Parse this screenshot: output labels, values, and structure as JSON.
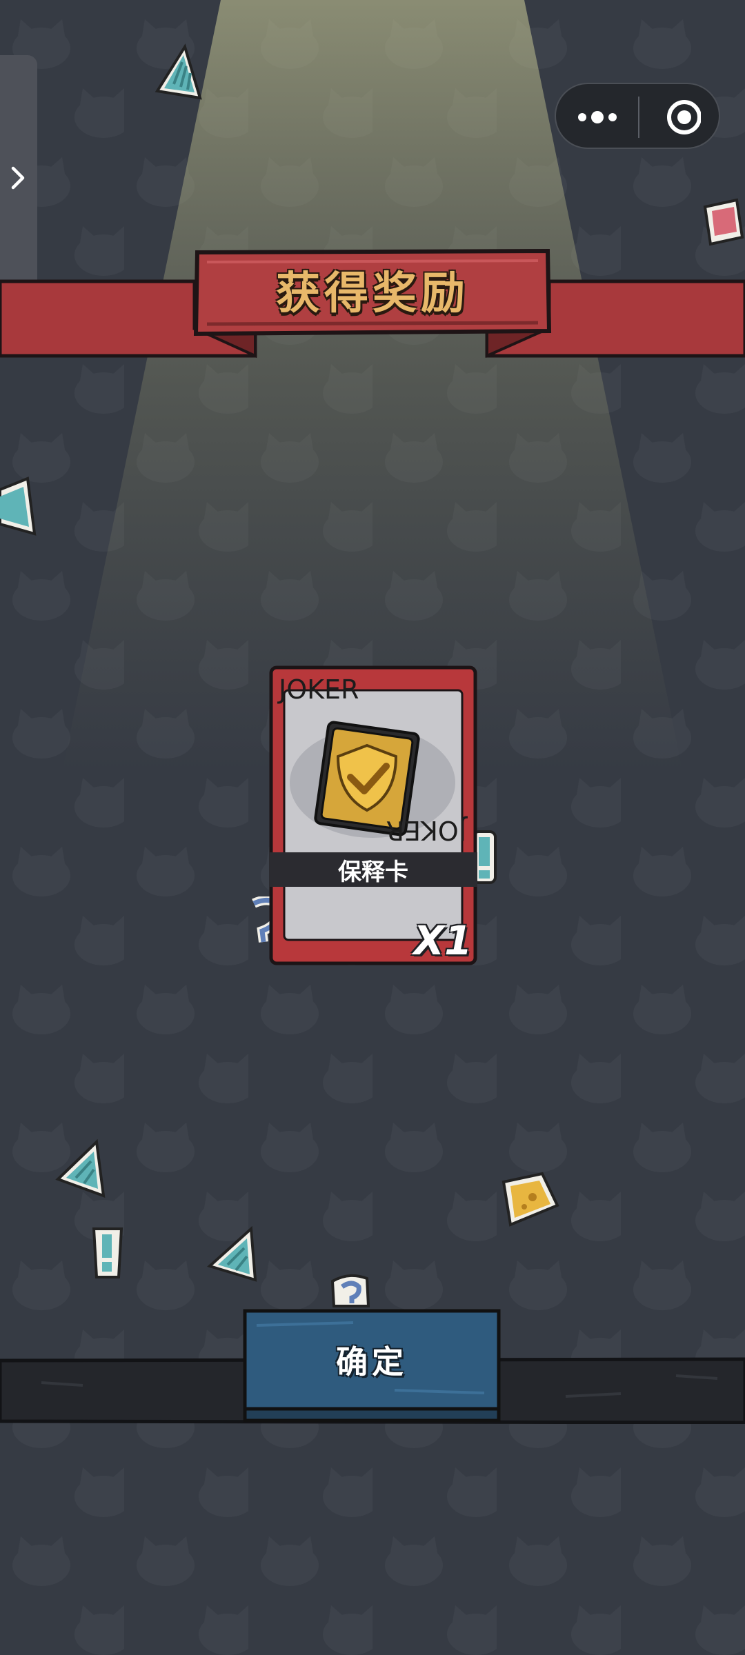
{
  "header": {
    "title": "获得奖励"
  },
  "capsule": {
    "more_icon": "more-dots-icon",
    "close_icon": "target-close-icon"
  },
  "side_tab": {
    "icon": "chevron-right-icon"
  },
  "reward": {
    "card_corner_text": "JOKER",
    "item_name": "保释卡",
    "quantity": "X1",
    "icon": "gold-shield-check-icon"
  },
  "actions": {
    "confirm_label": "确定"
  },
  "colors": {
    "background": "#363b44",
    "banner_red": "#a8393c",
    "card_border": "#b8383b",
    "button_blue": "#2f5b7e",
    "title_gold": "#e8b86a"
  }
}
